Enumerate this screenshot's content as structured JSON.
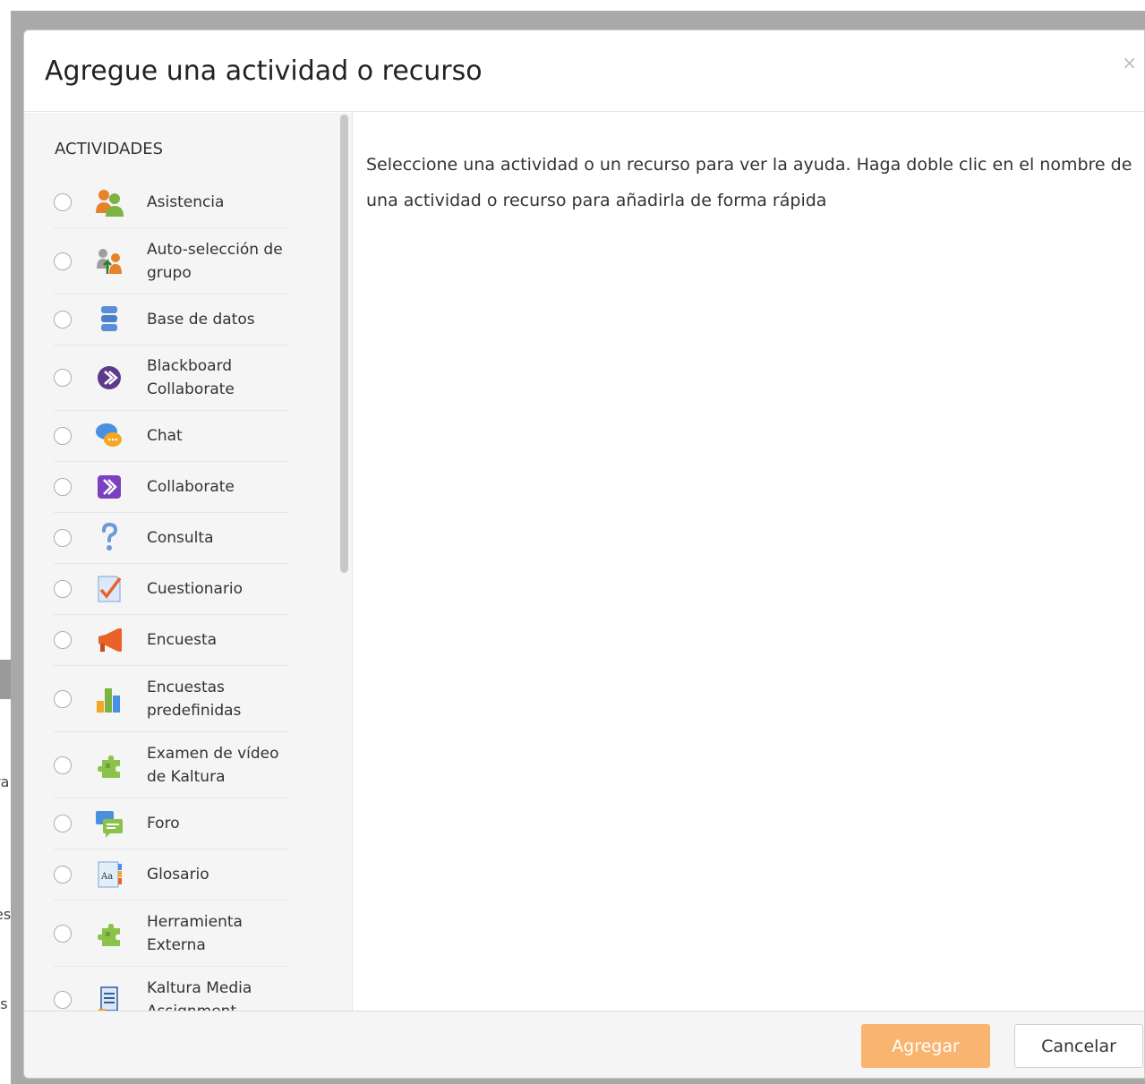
{
  "modal": {
    "title": "Agregue una actividad o recurso",
    "close_label": "×",
    "section_heading": "ACTIVIDADES",
    "help_text": "Seleccione una actividad o un recurso para ver la ayuda. Haga doble clic en el nombre de una actividad o recurso para añadirla de forma rápida",
    "add_button": "Agregar",
    "cancel_button": "Cancelar"
  },
  "activities": [
    {
      "label": "Asistencia",
      "icon": "attendance-icon"
    },
    {
      "label": "Auto-selección de grupo",
      "icon": "group-selection-icon"
    },
    {
      "label": "Base de datos",
      "icon": "database-icon"
    },
    {
      "label": "Blackboard Collaborate",
      "icon": "blackboard-collaborate-icon"
    },
    {
      "label": "Chat",
      "icon": "chat-icon"
    },
    {
      "label": "Collaborate",
      "icon": "collaborate-icon"
    },
    {
      "label": "Consulta",
      "icon": "question-icon"
    },
    {
      "label": "Cuestionario",
      "icon": "quiz-icon"
    },
    {
      "label": "Encuesta",
      "icon": "megaphone-icon"
    },
    {
      "label": "Encuestas predefinidas",
      "icon": "bar-chart-icon"
    },
    {
      "label": "Examen de vídeo de Kaltura",
      "icon": "puzzle-icon"
    },
    {
      "label": "Foro",
      "icon": "forum-icon"
    },
    {
      "label": "Glosario",
      "icon": "glossary-icon"
    },
    {
      "label": "Herramienta Externa",
      "icon": "puzzle-icon"
    },
    {
      "label": "Kaltura Media Assignment",
      "icon": "media-assignment-icon"
    }
  ],
  "background_peek": [
    "ra",
    "es",
    "(s"
  ],
  "colors": {
    "accent": "#f9b470",
    "panel_bg": "#f5f5f5",
    "overlay": "#a9a9a9"
  }
}
